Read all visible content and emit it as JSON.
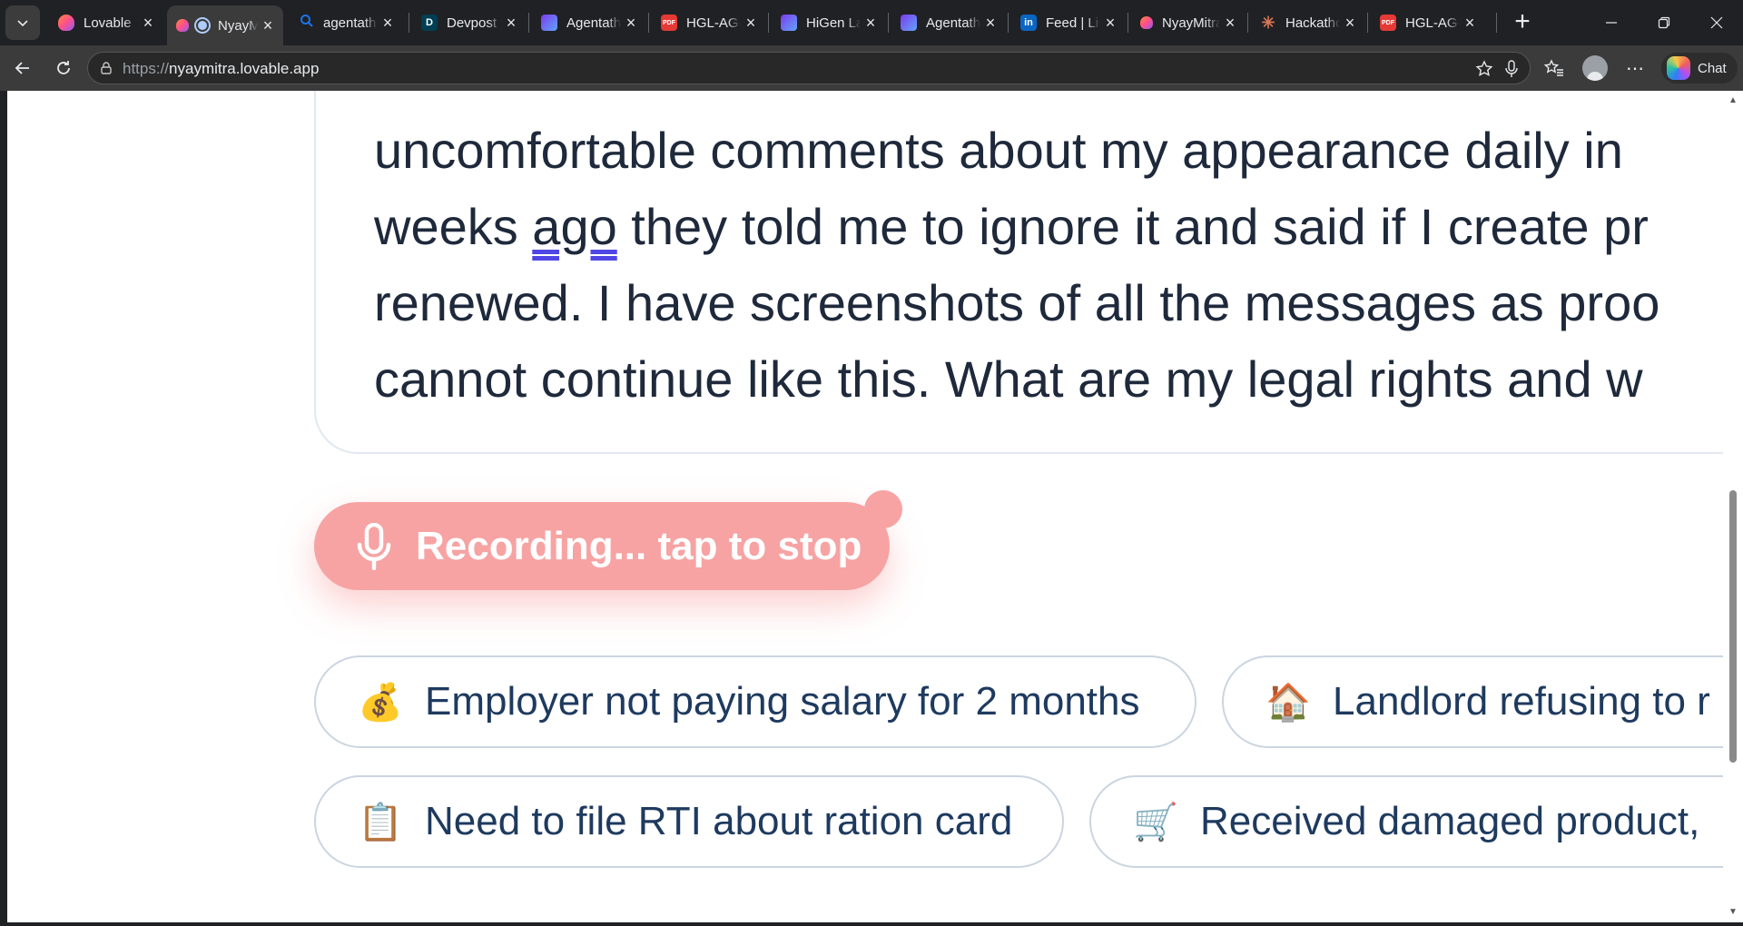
{
  "tabs": [
    {
      "title": "Lovable",
      "favicon_color": "#ff4f8b",
      "active": false
    },
    {
      "title": "NyayMitra",
      "favicon_color": "#ff4f8b",
      "active": true
    },
    {
      "title": "agentathon",
      "favicon_color": "#1a73e8",
      "active": false
    },
    {
      "title": "Devpost",
      "favicon_color": "#003e54",
      "favicon_text": "D",
      "active": false
    },
    {
      "title": "Agentathon",
      "favicon_color": "#6d5bf2",
      "active": false
    },
    {
      "title": "HGL-AG-",
      "favicon_color": "#e53935",
      "favicon_text": "PDF",
      "active": false
    },
    {
      "title": "HiGen Labs",
      "favicon_color": "#6d5bf2",
      "active": false
    },
    {
      "title": "Agentathon",
      "favicon_color": "#6d5bf2",
      "active": false
    },
    {
      "title": "Feed | LinkedIn",
      "favicon_color": "#0a66c2",
      "favicon_text": "in",
      "active": false
    },
    {
      "title": "NyayMitra",
      "favicon_color": "#ff4f8b",
      "active": false
    },
    {
      "title": "Hackathon",
      "favicon_color": "#d97757",
      "active": false
    },
    {
      "title": "HGL-AG-",
      "favicon_color": "#e53935",
      "favicon_text": "PDF",
      "active": false
    }
  ],
  "address_bar": {
    "protocol": "https://",
    "host": "nyaymitra.lovable.app"
  },
  "toolbar": {
    "chat_label": "Chat"
  },
  "complaint": {
    "lines": [
      "uncomfortable comments about my appearance daily in",
      "they told me to ignore it and said if I create pr",
      "renewed. I have screenshots of all the messages as proo",
      "cannot continue like this. What are my legal rights and w"
    ],
    "line2_prefix": "weeks ",
    "line2_flagged_word": "ago"
  },
  "record_button": {
    "label": "Recording... tap to stop",
    "color": "#f7a3a3"
  },
  "suggestions": [
    {
      "emoji": "💰",
      "text": "Employer not paying salary for 2 months"
    },
    {
      "emoji": "🏠",
      "text": "Landlord refusing to r"
    },
    {
      "emoji": "📋",
      "text": "Need to file RTI about ration card"
    },
    {
      "emoji": "🛒",
      "text": "Received damaged product,"
    }
  ]
}
